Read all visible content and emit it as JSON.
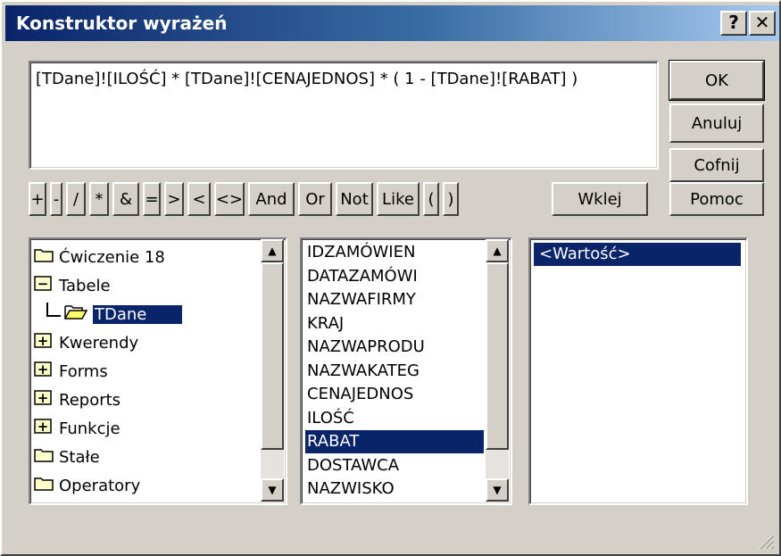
{
  "window": {
    "title": "Konstruktor wyrażeń",
    "help_label": "?",
    "close_label": "✕"
  },
  "expression": {
    "value": "[TDane]![ILOŚĆ] * [TDane]![CENAJEDNOS] * ( 1 - [TDane]![RABAT] )"
  },
  "buttons": {
    "ok": "OK",
    "cancel": "Anuluj",
    "undo": "Cofnij",
    "paste": "Wklej",
    "help": "Pomoc"
  },
  "operators": [
    "+",
    "-",
    "/",
    "*",
    "&",
    "=",
    ">",
    "<",
    "<>",
    "And",
    "Or",
    "Not",
    "Like",
    "(",
    ")"
  ],
  "tree": {
    "items": [
      {
        "label": "Ćwiczenie 18",
        "icon": "folder-icon"
      },
      {
        "label": "Tabele",
        "icon": "collapse-icon"
      },
      {
        "label": "TDane",
        "icon": "open-folder-icon",
        "selected": true
      },
      {
        "label": "Kwerendy",
        "icon": "expand-icon"
      },
      {
        "label": "Forms",
        "icon": "expand-icon"
      },
      {
        "label": "Reports",
        "icon": "expand-icon"
      },
      {
        "label": "Funkcje",
        "icon": "expand-icon"
      },
      {
        "label": "Stałe",
        "icon": "folder-icon"
      },
      {
        "label": "Operatory",
        "icon": "folder-icon"
      }
    ]
  },
  "fields": {
    "items": [
      "IDZAMÓWIEN",
      "DATAZAMÓWI",
      "NAZWAFIRMY",
      "KRAJ",
      "NAZWAPRODU",
      "NAZWAKATEG",
      "CENAJEDNOS",
      "ILOŚĆ",
      "RABAT",
      "DOSTAWCA",
      "NAZWISKO"
    ],
    "selected": "RABAT"
  },
  "values": {
    "items": [
      "<Wartość>"
    ],
    "selected": "<Wartość>"
  }
}
